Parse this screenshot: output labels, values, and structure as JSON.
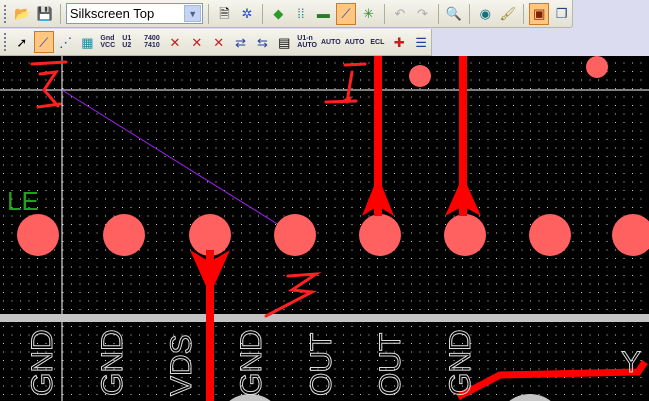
{
  "toolbar1": {
    "layer_select": {
      "value": "Silkscreen Top"
    },
    "buttons": [
      "open-icon",
      "save-icon",
      "layer-properties-icon",
      "refresh-icon",
      "component-icon",
      "nets-icon",
      "board-icon",
      "route-icon",
      "ratsnest-icon",
      "undo-icon",
      "redo-icon",
      "zoom-icon",
      "view-icon",
      "paint-icon",
      "active-tool-icon",
      "window-icon"
    ]
  },
  "toolbar2": {
    "buttons": [
      {
        "name": "select",
        "text": "➚"
      },
      {
        "name": "route",
        "text": "⟋"
      },
      {
        "name": "select-net",
        "text": "⋰"
      },
      {
        "name": "add-component",
        "text": "▦"
      },
      {
        "name": "gnd-vcc",
        "text": "Gnd VCC"
      },
      {
        "name": "u1-u2",
        "text": "U1 U2"
      },
      {
        "name": "7400-7410",
        "text": "7400 7410"
      },
      {
        "name": "delete-route",
        "text": "✕"
      },
      {
        "name": "delete-nets",
        "text": "✕"
      },
      {
        "name": "delete-component",
        "text": "✕"
      },
      {
        "name": "swap",
        "text": "⇄"
      },
      {
        "name": "gate-swap",
        "text": "⇆"
      },
      {
        "name": "properties",
        "text": "▤"
      },
      {
        "name": "auto-name",
        "text": "U1-n AUTO"
      },
      {
        "name": "auto-route",
        "text": "AUTO"
      },
      {
        "name": "auto-gate",
        "text": "AUTO"
      },
      {
        "name": "ecl",
        "text": "ECL"
      },
      {
        "name": "add-pin",
        "text": "✚"
      },
      {
        "name": "list",
        "text": "☰"
      }
    ]
  },
  "board": {
    "side_label": "LE",
    "pad_labels": [
      "GND",
      "GND",
      "VDS",
      "GND",
      "OUT",
      "OUT",
      "GND",
      "Y"
    ],
    "annotations": [
      "1",
      "2",
      "3"
    ],
    "colors": {
      "pad": "#ff6060",
      "trace": "#ff0000",
      "grid": "#ffffff",
      "silk": "#dddddd",
      "net": "#a020f0",
      "annotation": "#ff2020"
    }
  }
}
